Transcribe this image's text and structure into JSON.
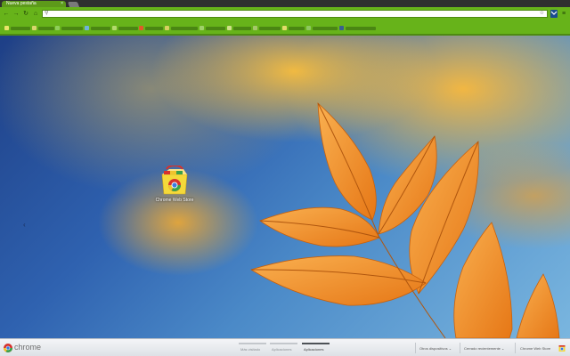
{
  "tab": {
    "title": "Nueva pestaña",
    "close": "×"
  },
  "toolbar": {
    "back": "←",
    "forward": "→",
    "reload": "↻",
    "home": "⌂",
    "omnibox_value": "",
    "star": "☆",
    "menu": "≡"
  },
  "icons": {
    "back": "back-arrow-icon",
    "forward": "forward-arrow-icon",
    "reload": "reload-icon",
    "home": "home-icon",
    "search": "search-icon",
    "star": "star-icon",
    "extension": "extension-icon",
    "menu": "wrench-menu-icon",
    "prev": "chevron-left-icon"
  },
  "colors": {
    "frame": "#67b31a",
    "tab_active": "#5d9a1a",
    "footer": "#e8eaed"
  },
  "apps": {
    "webstore_label": "Chrome Web Store",
    "prev_page": "‹"
  },
  "footer": {
    "brand": "chrome",
    "sections": [
      "Más visitado",
      "Aplicaciones",
      "Aplicaciones"
    ],
    "active_section": 2,
    "other_devices": "Otros dispositivos",
    "recently_closed": "Cerrado recientemente",
    "webstore_link": "Chrome Web Store"
  }
}
